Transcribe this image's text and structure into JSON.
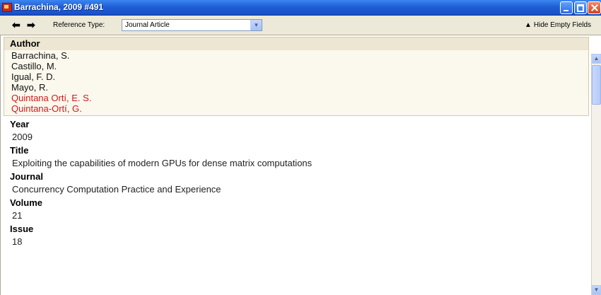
{
  "window": {
    "title": "Barrachina, 2009 #491"
  },
  "toolbar": {
    "back_icon": "arrow-left-icon",
    "forward_icon": "arrow-right-icon",
    "reference_type_label": "Reference Type:",
    "reference_type_value": "Journal Article",
    "hide_empty_label": "Hide Empty Fields"
  },
  "record": {
    "author": {
      "label": "Author",
      "names": [
        {
          "text": "Barrachina, S.",
          "color": "#111111"
        },
        {
          "text": "Castillo, M.",
          "color": "#111111"
        },
        {
          "text": "Igual, F. D.",
          "color": "#111111"
        },
        {
          "text": "Mayo, R.",
          "color": "#111111"
        },
        {
          "text": "Quintana Ortí, E. S.",
          "color": "#d11a1a"
        },
        {
          "text": "Quintana-Ortí, G.",
          "color": "#d11a1a"
        }
      ]
    },
    "year": {
      "label": "Year",
      "value": "2009"
    },
    "title": {
      "label": "Title",
      "value": "Exploiting the capabilities of modern GPUs for dense matrix computations"
    },
    "journal": {
      "label": "Journal",
      "value": "Concurrency Computation Practice and Experience"
    },
    "volume": {
      "label": "Volume",
      "value": "21"
    },
    "issue": {
      "label": "Issue",
      "value": "18"
    }
  }
}
